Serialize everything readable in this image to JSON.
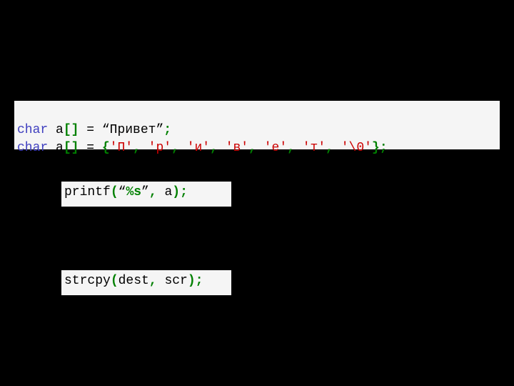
{
  "snippets": {
    "line1": {
      "kw": "char",
      "decl": " a",
      "lb": "[]",
      "eq": " = ",
      "openq": "“",
      "str": "Привет",
      "closeq": "”",
      "semi": ";"
    },
    "line2": {
      "kw": "char",
      "decl": " a",
      "lb": "[]",
      "eq": " = ",
      "open": "{",
      "c1": "'П'",
      "sep": ", ",
      "c2": "'р'",
      "c3": "'и'",
      "c4": "'в'",
      "c5": "'е'",
      "c6": "'т'",
      "c7": "'\\0'",
      "close": "};"
    },
    "printf": {
      "fn": "printf",
      "open": "(",
      "openq": "“",
      "fmt": "%s",
      "closeq": "”",
      "sep": ", ",
      "arg": "a",
      "close": ");"
    },
    "strcpy": {
      "fn": "strcpy",
      "open": "(",
      "arg1": "dest",
      "sep": ", ",
      "arg2": "scr",
      "close": ");"
    }
  }
}
